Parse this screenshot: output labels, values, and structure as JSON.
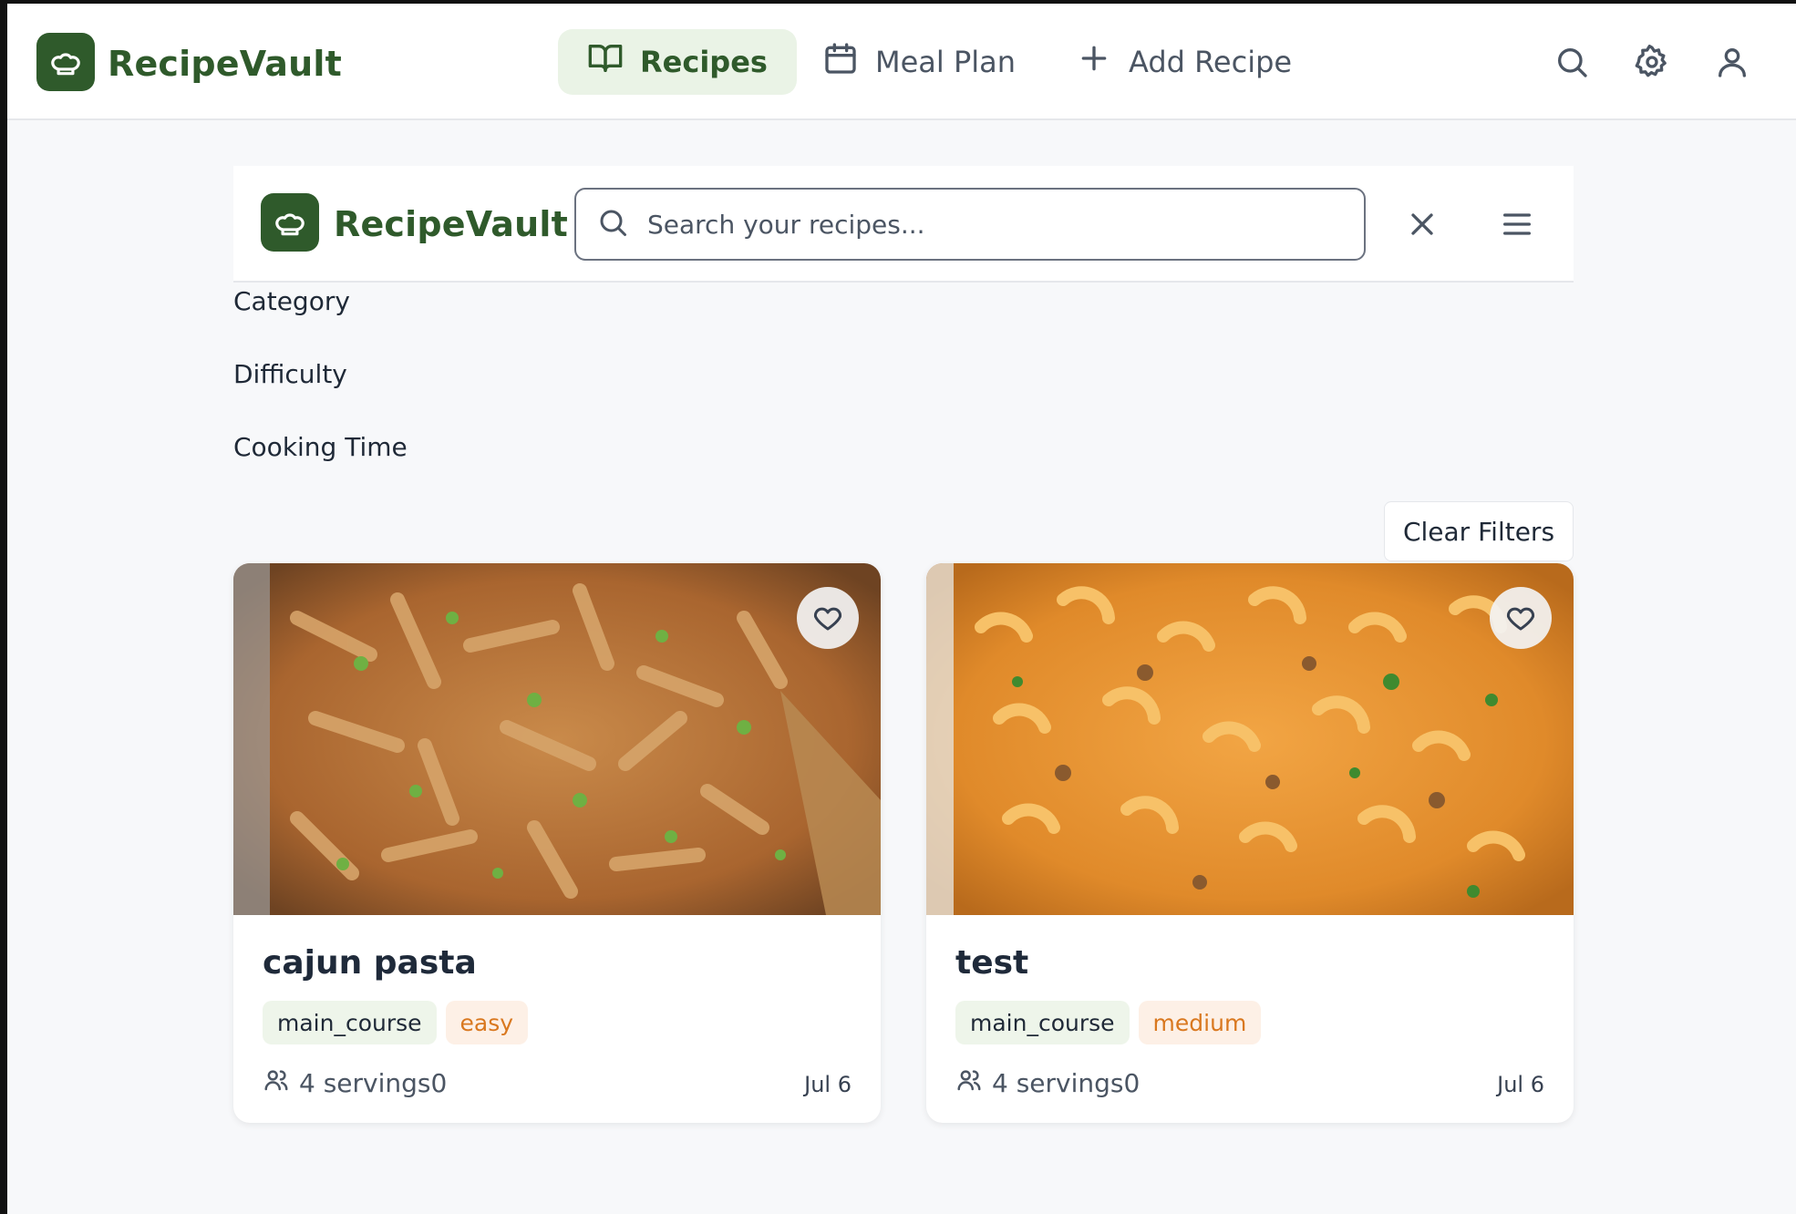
{
  "app": {
    "name": "RecipeVault"
  },
  "nav": {
    "items": [
      {
        "label": "Recipes",
        "icon": "book-open-icon",
        "active": true
      },
      {
        "label": "Meal Plan",
        "icon": "calendar-icon",
        "active": false
      },
      {
        "label": "Add Recipe",
        "icon": "plus-icon",
        "active": false
      }
    ],
    "actions": [
      "search-icon",
      "gear-icon",
      "user-icon"
    ]
  },
  "inner_header": {
    "brand": "RecipeVault",
    "search_placeholder": "Search your recipes...",
    "search_value": ""
  },
  "filters": {
    "labels": [
      "Category",
      "Difficulty",
      "Cooking Time"
    ],
    "clear_label": "Clear Filters"
  },
  "recipes": [
    {
      "title": "cajun pasta",
      "category": "main_course",
      "difficulty": "easy",
      "servings": "4 servings0",
      "date": "Jul 6",
      "image_icon": "penne-pasta-photo"
    },
    {
      "title": "test",
      "category": "main_course",
      "difficulty": "medium",
      "servings": "4 servings0",
      "date": "Jul 6",
      "image_icon": "macaroni-photo"
    }
  ],
  "colors": {
    "brand": "#2f5a2b",
    "active_nav_bg": "#eaf3e6",
    "tag_category_bg": "#eef5ea",
    "tag_difficulty_bg": "#fdf0e6",
    "tag_difficulty_text": "#d9781f"
  }
}
